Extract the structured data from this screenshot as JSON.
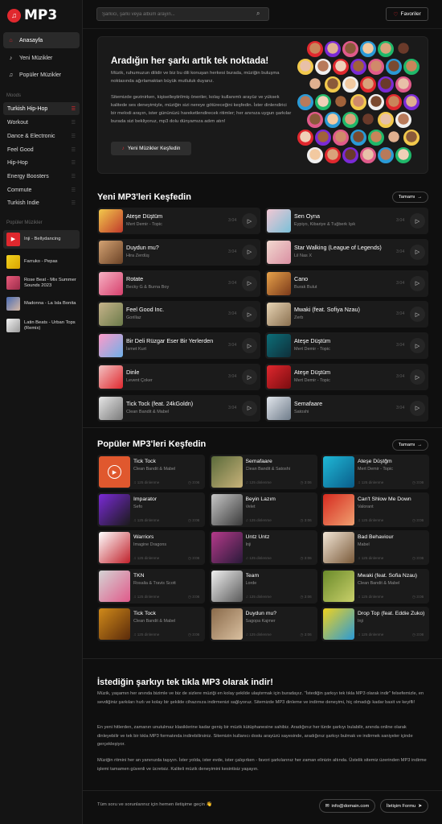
{
  "app": {
    "logo_text": "MP3"
  },
  "sidebar": {
    "nav": [
      {
        "label": "Anasayfa",
        "icon": "home-icon"
      },
      {
        "label": "Yeni Müzikler",
        "icon": "music-note-icon"
      },
      {
        "label": "Popüler Müzikler",
        "icon": "music-list-icon"
      }
    ],
    "moods_title": "Moods",
    "moods": [
      "Turkish Hip-Hop",
      "Workout",
      "Dance & Electronic",
      "Feel Good",
      "Hip-Hop",
      "Energy Boosters",
      "Commute",
      "Turkish Indie"
    ],
    "playlists_title": "Popüler Müzikler",
    "playlists": [
      {
        "label": "Inji - Bellydancing"
      },
      {
        "label": "Farruko - Pepas"
      },
      {
        "label": "Rose Beat - Mix Summer Sounds 2023"
      },
      {
        "label": "Madonna - La Isla Bonita"
      },
      {
        "label": "Latin Beats - Urban Tops (Remix)"
      }
    ]
  },
  "header": {
    "search_placeholder": "Şarkıcı, şarkı veya albüm arayın...",
    "favorites_label": "Favoriler"
  },
  "hero": {
    "title": "Aradığın her şarkı artık tek noktada!",
    "p1": "Müzik, ruhumuzun dilidir ve biz bu dili konuşan herkesi burada, müziğin buluşma noktasında ağırlamaktan büyük mutluluk duyarız.",
    "p2": "Sitemizde gezinirken, kişiselleştirilmiş öneriler, kolay kullanımlı arayüz ve yüksek kalitede ses deneyimiyle, müziğin sizi nereye götüreceğini keşfedin. İster dinlendirici bir melodi arayın, ister gününüzü hareketlendirecek ritimler; her anınıza uygun şarkılar burada sizi bekliyoruz, mp3 dolu dünyamıza adım atın!",
    "button_label": "Yeni Müzikler Keşfedin"
  },
  "new_section": {
    "title": "Yeni MP3'leri Keşfedin",
    "more_label": "Tamamı",
    "tracks": [
      {
        "title": "Ateşe Düştüm",
        "artist": "Mert Demir - Topic",
        "duration": "3:04"
      },
      {
        "title": "Sen Oyna",
        "artist": "Eypiyo, Kibariye & Tuğberk Işık",
        "duration": "3:04"
      },
      {
        "title": "Duydun mu?",
        "artist": "Hira Zerdüş",
        "duration": "3:04"
      },
      {
        "title": "Star Walking (League of Legends)",
        "artist": "Lil Nas X",
        "duration": "3:04"
      },
      {
        "title": "Rotate",
        "artist": "Becky G & Burna Boy",
        "duration": "3:04"
      },
      {
        "title": "Cano",
        "artist": "Burak Bulut",
        "duration": "3:04"
      },
      {
        "title": "Feel Good Inc.",
        "artist": "Gorillaz",
        "duration": "3:04"
      },
      {
        "title": "Mwaki (feat. Sofiya Nzau)",
        "artist": "Zerb",
        "duration": "3:04"
      },
      {
        "title": "Bir Deli Rüzgar Eser Bir Yerlerden",
        "artist": "İsmet Kurt",
        "duration": "3:04"
      },
      {
        "title": "Ateşe Düştüm",
        "artist": "Mert Demir - Topic",
        "duration": "3:04"
      },
      {
        "title": "Dinle",
        "artist": "Levent Çoker",
        "duration": "3:04"
      },
      {
        "title": "Ateşe Düştüm",
        "artist": "Mert Demir - Topic",
        "duration": "3:04"
      },
      {
        "title": "Tick Tock (feat. 24kGoldn)",
        "artist": "Clean Bandit & Mabel",
        "duration": "3:04"
      },
      {
        "title": "Semafaare",
        "artist": "Satoshi",
        "duration": "3:04"
      }
    ]
  },
  "popular_section": {
    "title": "Popüler MP3'leri Keşfedin",
    "more_label": "Tamamı",
    "tracks": [
      {
        "title": "Tick Tock",
        "artist": "Clean Bandit & Mabel",
        "plays": "125 dinlenme",
        "duration": "3:06"
      },
      {
        "title": "Semafaare",
        "artist": "Clean Bandit & Satoshi",
        "plays": "125 dinlenme",
        "duration": "3:06"
      },
      {
        "title": "Ateşe Düştğm",
        "artist": "Mert Demir - Topic",
        "plays": "125 dinlenme",
        "duration": "3:06"
      },
      {
        "title": "Imparator",
        "artist": "Sefo",
        "plays": "125 dinlenme",
        "duration": "3:06"
      },
      {
        "title": "Beyin Lazım",
        "artist": "Velet",
        "plays": "125 dinlenme",
        "duration": "3:06"
      },
      {
        "title": "Can't Shlow Me Down",
        "artist": "Valorant",
        "plays": "125 dinlenme",
        "duration": "3:06"
      },
      {
        "title": "Warriors",
        "artist": "Imagine Dragons",
        "plays": "125 dinlenme",
        "duration": "3:06"
      },
      {
        "title": "Untz Untz",
        "artist": "Inji",
        "plays": "125 dinlenme",
        "duration": "3:06"
      },
      {
        "title": "Bad Behaviour",
        "artist": "Mabel",
        "plays": "125 dinlenme",
        "duration": "3:06"
      },
      {
        "title": "TKN",
        "artist": "Rosalia & Travis Scott",
        "plays": "125 dinlenme",
        "duration": "3:06"
      },
      {
        "title": "Team",
        "artist": "Lorde",
        "plays": "125 dinlenme",
        "duration": "3:06"
      },
      {
        "title": "Mwaki (feat. Sofia Nzau)",
        "artist": "Clean Bandit & Mabel",
        "plays": "125 dinlenme",
        "duration": "3:06"
      },
      {
        "title": "Tick Tock",
        "artist": "Clean Bandit & Mabel",
        "plays": "125 dinlenme",
        "duration": "3:06"
      },
      {
        "title": "Duydun mu?",
        "artist": "Sagopa Kajmer",
        "plays": "125 dinlenme",
        "duration": "3:06"
      },
      {
        "title": "Drop Top (feat. Eddie Zuko)",
        "artist": "Inji",
        "plays": "125 dinlenme",
        "duration": "3:06"
      }
    ]
  },
  "bottom": {
    "title": "İstediğin şarkıyı tek tıkla MP3 olarak indir!",
    "p1": "Müzik, yaşamın her anında bizimle ve biz de sizlere müziği en kolay şekilde ulaştırmak için buradayız. \"İstediğin şarkıyı tek tıkla MP3 olarak indir\" felsefemizle, en sevdiğiniz şarkıları hızlı ve kolay bir şekilde cihazınıza indirmenizi sağlıyoruz. Sitemizde MP3 dinleme ve indirme deneyimi, hiç olmadığı kadar basit ve keyifli!",
    "p2": "En yeni hitlerden, zamanın unutulmaz klasiklerine kadar geniş bir müzik kütüphanesine sahibiz. Aradığınız her türde şarkıyı bulabilir, anında online olarak dinleyebilir ve tek bir tıkla MP3 formatında indirebilirsiniz. Sitemizin kullanıcı dostu arayüzü sayesinde, aradığınız şarkıyı bulmak ve indirmek saniyeler içinde gerçekleşiyor.",
    "p3": "Müziğin ritmini her an yanınızda taşıyın. İster yolda, ister evde, ister çalışırken - favori şarkılarınız her zaman elinizin altında. Üstelik sitemiz üzerinden MP3 indirme işlemi tamamen güvenli ve ücretsiz. Kaliteli müzik deneyimini kesintisiz yaşayın."
  },
  "footer": {
    "text": "Tüm soru ve sorunlarınız için hemen iletişime geçin 👋",
    "email": "info@domain.com",
    "form_label": "İletişim Formu"
  },
  "colors": {
    "accent": "#e0282e",
    "background": "#0f0f0f",
    "card": "#1b1b1b"
  }
}
